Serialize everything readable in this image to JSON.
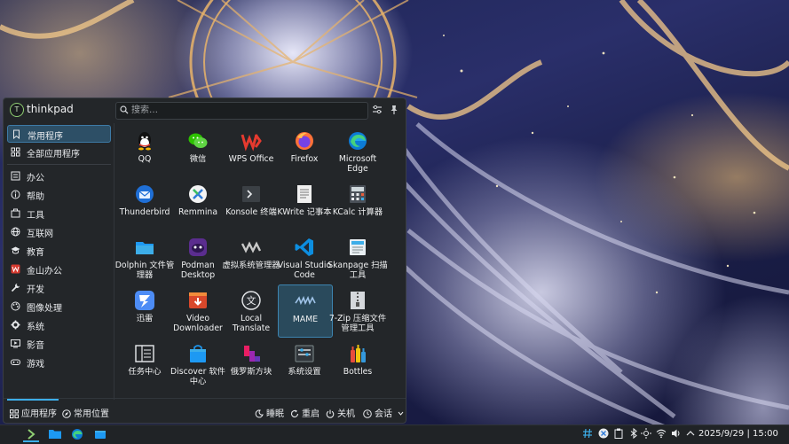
{
  "user": {
    "initial": "T",
    "name": "thinkpad"
  },
  "search": {
    "placeholder": "搜索…"
  },
  "sidebar": {
    "items": [
      {
        "label": "常用程序",
        "icon": "bookmark-icon"
      },
      {
        "label": "全部应用程序",
        "icon": "grid-icon"
      },
      {
        "label": "办公",
        "icon": "office-icon"
      },
      {
        "label": "帮助",
        "icon": "help-icon"
      },
      {
        "label": "工具",
        "icon": "toolbox-icon"
      },
      {
        "label": "互联网",
        "icon": "globe-icon"
      },
      {
        "label": "教育",
        "icon": "education-icon"
      },
      {
        "label": "金山办公",
        "icon": "wps-icon"
      },
      {
        "label": "开发",
        "icon": "wrench-icon"
      },
      {
        "label": "图像处理",
        "icon": "graphics-icon"
      },
      {
        "label": "系统",
        "icon": "gear-icon"
      },
      {
        "label": "影音",
        "icon": "multimedia-icon"
      },
      {
        "label": "游戏",
        "icon": "gamepad-icon"
      }
    ]
  },
  "apps": [
    {
      "label": "QQ",
      "icon": "qq-icon"
    },
    {
      "label": "微信",
      "icon": "wechat-icon"
    },
    {
      "label": "WPS Office",
      "icon": "wps-office-icon"
    },
    {
      "label": "Firefox",
      "icon": "firefox-icon"
    },
    {
      "label": "Microsoft Edge",
      "icon": "edge-icon"
    },
    {
      "label": "Thunderbird",
      "icon": "thunderbird-icon"
    },
    {
      "label": "Remmina",
      "icon": "remmina-icon"
    },
    {
      "label": "Konsole 终端",
      "icon": "konsole-icon"
    },
    {
      "label": "KWrite 记事本",
      "icon": "kwrite-icon"
    },
    {
      "label": "KCalc 计算器",
      "icon": "kcalc-icon"
    },
    {
      "label": "Dolphin 文件管理器",
      "icon": "dolphin-icon"
    },
    {
      "label": "Podman Desktop",
      "icon": "podman-icon"
    },
    {
      "label": "虚拟系统管理器",
      "icon": "virt-manager-icon"
    },
    {
      "label": "Visual Studio Code",
      "icon": "vscode-icon"
    },
    {
      "label": "Skanpage 扫描工具",
      "icon": "skanpage-icon"
    },
    {
      "label": "迅雷",
      "icon": "xunlei-icon"
    },
    {
      "label": "Video Downloader",
      "icon": "video-downloader-icon"
    },
    {
      "label": "Local Translate",
      "icon": "translate-icon"
    },
    {
      "label": "MAME",
      "icon": "mame-icon"
    },
    {
      "label": "7-Zip 压缩文件管理工具",
      "icon": "7zip-icon"
    },
    {
      "label": "任务中心",
      "icon": "task-center-icon"
    },
    {
      "label": "Discover 软件中心",
      "icon": "discover-icon"
    },
    {
      "label": "俄罗斯方块",
      "icon": "tetris-icon"
    },
    {
      "label": "系统设置",
      "icon": "system-settings-icon"
    },
    {
      "label": "Bottles",
      "icon": "bottles-icon"
    }
  ],
  "bottom": {
    "apps_tab": "应用程序",
    "places_tab": "常用位置",
    "sleep": "睡眠",
    "restart": "重启",
    "shutdown": "关机",
    "session": "会话"
  },
  "taskbar": {
    "clock": "2025/9/29 | 15:00"
  },
  "colors": {
    "accent": "#3daee9",
    "panel": "#232629",
    "taskbar": "#202326"
  }
}
